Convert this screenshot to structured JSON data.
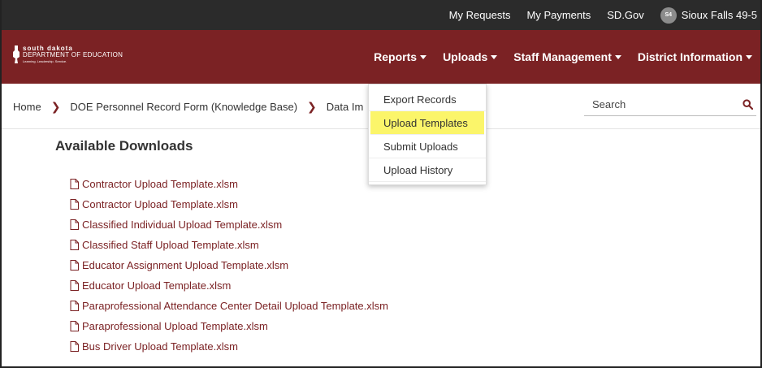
{
  "topbar": {
    "my_requests": "My Requests",
    "my_payments": "My Payments",
    "sd_gov": "SD.Gov",
    "avatar_initials": "S4",
    "district": "Sioux Falls 49-5"
  },
  "logo": {
    "line1": "south dakota",
    "line2": "DEPARTMENT OF EDUCATION",
    "tagline": "Learning. Leadership. Service."
  },
  "nav": {
    "reports": "Reports",
    "uploads": "Uploads",
    "staff_management": "Staff Management",
    "district_information": "District Information"
  },
  "breadcrumb": {
    "home": "Home",
    "kb": "DOE Personnel Record Form (Knowledge Base)",
    "current": "Data Im"
  },
  "search": {
    "placeholder": "Search"
  },
  "uploads_menu": {
    "items": [
      "Export Records",
      "Upload Templates",
      "Submit Uploads",
      "Upload History"
    ],
    "highlighted": "Upload Templates"
  },
  "main": {
    "heading": "Available Downloads",
    "downloads": [
      "Contractor Upload Template.xlsm",
      "Contractor Upload Template.xlsm",
      "Classified Individual Upload Template.xlsm",
      "Classified Staff Upload Template.xlsm",
      "Educator Assignment Upload Template.xlsm",
      "Educator Upload Template.xlsm",
      "Paraprofessional Attendance Center Detail Upload Template.xlsm",
      "Paraprofessional Upload Template.xlsm",
      "Bus Driver Upload Template.xlsm"
    ]
  },
  "colors": {
    "brand_maroon": "#7b2224",
    "topbar_bg": "#2b2b2b",
    "highlight_yellow": "#fbf56a"
  },
  "icons": {
    "file": "file-icon",
    "chevron": "chevron-right-icon",
    "search": "search-icon",
    "caret": "caret-down-icon"
  }
}
